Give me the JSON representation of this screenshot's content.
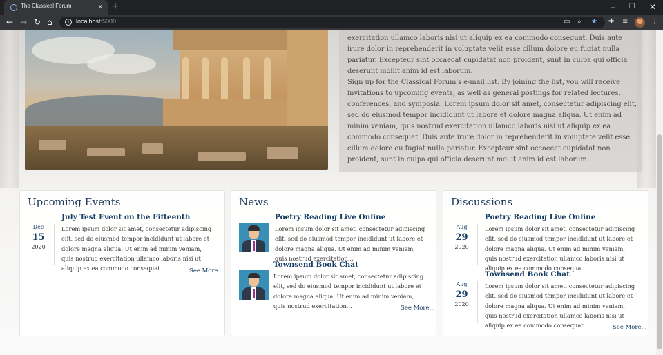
{
  "browser": {
    "tab_title": "The Classical Forum",
    "tab_close": "×",
    "new_tab": "+",
    "url_host": "localhost",
    "url_port": ":5000",
    "window_controls": {
      "minimize": "–",
      "restore": "❐",
      "close": "✕"
    },
    "nav": {
      "back": "←",
      "forward": "→",
      "reload": "↻",
      "home": "⌂"
    },
    "icons": [
      "cast-icon",
      "zoom-icon",
      "bookmark-star-icon",
      "extensions-icon",
      "media-icon",
      "profile-avatar",
      "menu-icon"
    ]
  },
  "intro": {
    "paragraph1": "exercitation ullamco laboris nisi ut aliquip ex ea commodo consequat. Duis aute irure dolor in reprehenderit in voluptate velit esse cillum dolore eu fugiat nulla pariatur. Excepteur sint occaecat cupidatat non proident, sunt in culpa qui officia deserunt mollit anim id est laborum.",
    "paragraph2": "Sign up for the Classical Forum's e-mail list. By joining the list, you will receive invitations to upcoming events, as well as general postings for related lectures, conferences, and symposia. Lorem ipsum dolor sit amet, consectetur adipiscing elit, sed do eiusmod tempor incididunt ut labore et dolore magna aliqua. Ut enim ad minim veniam, quis nostrud exercitation ullamco laboris nisi ut aliquip ex ea commodo consequat. Duis aute irure dolor in reprehenderit in voluptate velit esse cillum dolore eu fugiat nulla pariatur. Excepteur sint occaecat cupidatat non proident, sunt in culpa qui officia deserunt mollit anim id est laborum."
  },
  "events": {
    "title": "Upcoming Events",
    "items": [
      {
        "title": "July Test Event on the Fifteenth",
        "month": "Dec",
        "day": "15",
        "year": "2020",
        "text": "Lorem ipsum dolor sit amet, consectetur adipiscing elit, sed do eiusmod tempor incididunt ut labore et dolore magna aliqua. Ut enim ad minim veniam, quis nostrud exercitation ullamco laboris nisi ut aliquip ex ea commodo consequat."
      }
    ],
    "see_more": "See More..."
  },
  "news": {
    "title": "News",
    "items": [
      {
        "title": "Poetry Reading Live Online",
        "text": "Lorem ipsum dolor sit amet, consectetur adipiscing elit, sed do eiusmod tempor incididunt ut labore et dolore magna aliqua. Ut enim ad minim veniam, quis nostrud exercitation..."
      },
      {
        "title": "Townsend Book Chat",
        "text": "Lorem ipsum dolor sit amet, consectetur adipiscing elit, sed do eiusmod tempor incididunt ut labore et dolore magna aliqua. Ut enim ad minim veniam, quis nostrud exercitation..."
      }
    ],
    "see_more": "See More..."
  },
  "discussions": {
    "title": "Discussions",
    "items": [
      {
        "title": "Poetry Reading Live Online",
        "month": "Aug",
        "day": "29",
        "year": "2020",
        "text": "Lorem ipsum dolor sit amet, consectetur adipiscing elit, sed do eiusmod tempor incididunt ut labore et dolore magna aliqua. Ut enim ad minim veniam, quis nostrud exercitation ullamco laboris nisi ut aliquip ex ea commodo consequat."
      },
      {
        "title": "Townsend Book Chat",
        "month": "Aug",
        "day": "29",
        "year": "2020",
        "text": "Lorem ipsum dolor sit amet, consectetur adipiscing elit, sed do eiusmod tempor incididunt ut labore et dolore magna aliqua. Ut enim ad minim veniam, quis nostrud exercitation ullamco laboris nisi ut aliquip ex ea commodo consequat."
      }
    ],
    "see_more": "See More..."
  },
  "colors": {
    "heading": "#1f3a5a",
    "link": "#1a3f66",
    "chrome_dark": "#202124",
    "chrome_tab": "#35363a"
  }
}
